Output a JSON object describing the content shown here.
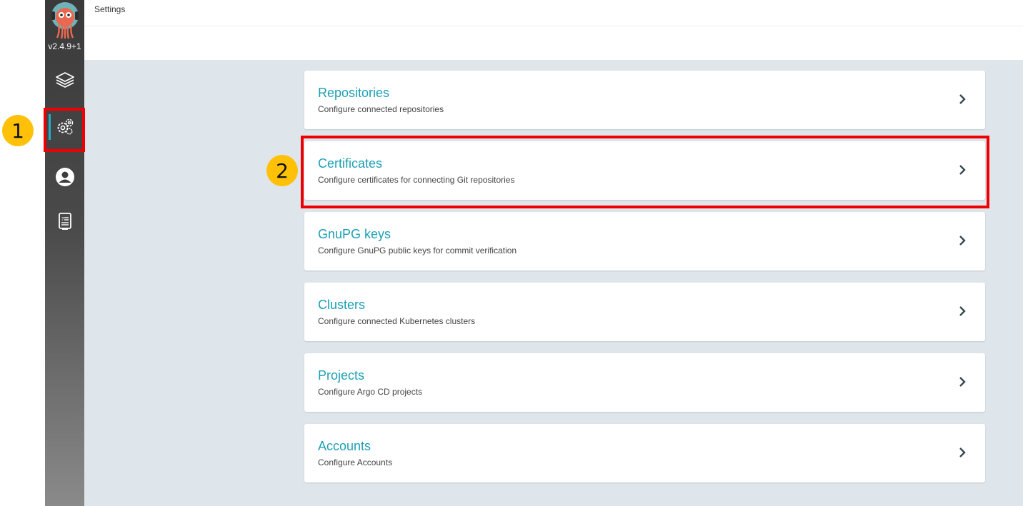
{
  "app": {
    "version": "v2.4.9+1"
  },
  "header": {
    "title": "Settings"
  },
  "sidebar": {
    "items": [
      {
        "id": "applications",
        "icon": "layers-icon"
      },
      {
        "id": "settings",
        "icon": "gear-icon",
        "active": true
      },
      {
        "id": "user-info",
        "icon": "user-circle-icon"
      },
      {
        "id": "documentation",
        "icon": "docs-icon"
      }
    ]
  },
  "settings": {
    "cards": [
      {
        "title": "Repositories",
        "description": "Configure connected repositories"
      },
      {
        "title": "Certificates",
        "description": "Configure certificates for connecting Git repositories"
      },
      {
        "title": "GnuPG keys",
        "description": "Configure GnuPG public keys for commit verification"
      },
      {
        "title": "Clusters",
        "description": "Configure connected Kubernetes clusters"
      },
      {
        "title": "Projects",
        "description": "Configure Argo CD projects"
      },
      {
        "title": "Accounts",
        "description": "Configure Accounts"
      }
    ]
  },
  "annotations": {
    "step1": "1",
    "step2": "2",
    "highlight_color": "#ee0000",
    "badge_color": "#ffc107"
  },
  "colors": {
    "accent": "#1c9fb4",
    "active_indicator": "#1fb0c8",
    "content_bg": "#dee6eb"
  }
}
